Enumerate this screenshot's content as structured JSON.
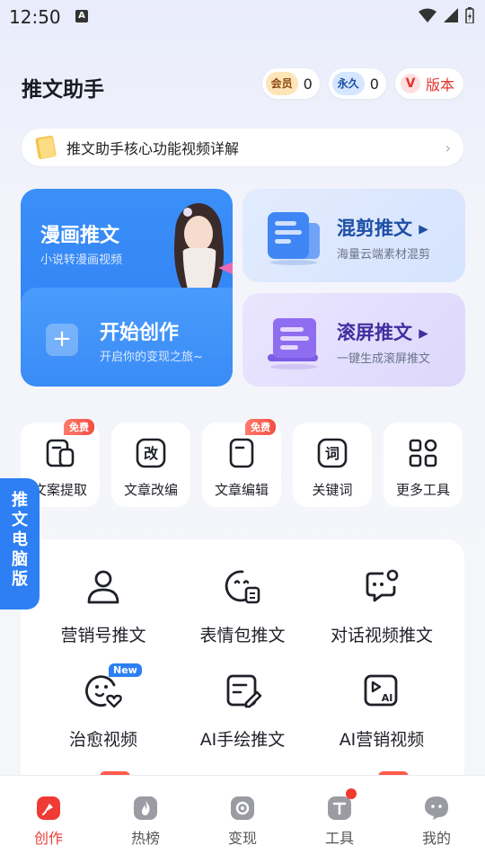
{
  "status_bar": {
    "time": "12:50",
    "indicator": "A"
  },
  "header": {
    "title": "推文助手",
    "vip_label": "会员",
    "vip_count": "0",
    "perm_label": "永久",
    "perm_count": "0",
    "version_icon": "V",
    "version_label": "版本"
  },
  "banner": {
    "text": "推文助手核心功能视频详解",
    "icon": "book-icon"
  },
  "cards": {
    "comic": {
      "title": "漫画推文",
      "subtitle": "小说转漫画视频"
    },
    "start": {
      "title": "开始创作",
      "subtitle": "开启你的变现之旅~"
    },
    "mix": {
      "title": "混剪推文 ▸",
      "subtitle": "海量云端素材混剪"
    },
    "scroll": {
      "title": "滚屏推文 ▸",
      "subtitle": "一键生成滚屏推文"
    }
  },
  "tools": [
    {
      "label": "文案提取",
      "badge": "免费",
      "icon": "extract-icon"
    },
    {
      "label": "文章改编",
      "badge": "",
      "icon": "rewrite-icon",
      "glyph": "改"
    },
    {
      "label": "文章编辑",
      "badge": "免费",
      "icon": "edit-doc-icon"
    },
    {
      "label": "关键词",
      "badge": "",
      "icon": "keyword-icon",
      "glyph": "词"
    },
    {
      "label": "更多工具",
      "badge": "",
      "icon": "grid-icon"
    }
  ],
  "pc_float": {
    "chars": [
      "推",
      "文",
      "电",
      "脑",
      "版"
    ]
  },
  "features": [
    {
      "label": "营销号推文",
      "icon": "user-icon"
    },
    {
      "label": "表情包推文",
      "icon": "emoji-icon"
    },
    {
      "label": "对话视频推文",
      "icon": "chat-icon"
    },
    {
      "label": "治愈视频",
      "icon": "heal-icon",
      "badge": "New"
    },
    {
      "label": "AI手绘推文",
      "icon": "draw-icon"
    },
    {
      "label": "AI营销视频",
      "icon": "ai-video-icon",
      "glyph": "AI"
    }
  ],
  "nav": [
    {
      "label": "创作",
      "active": true,
      "icon": "create-icon"
    },
    {
      "label": "热榜",
      "active": false,
      "icon": "fire-icon"
    },
    {
      "label": "变现",
      "active": false,
      "icon": "monetize-icon"
    },
    {
      "label": "工具",
      "active": false,
      "icon": "tools-icon",
      "dot": true
    },
    {
      "label": "我的",
      "active": false,
      "icon": "profile-icon"
    }
  ],
  "colors": {
    "accent": "#2d7ff3",
    "active": "#ef3b35"
  }
}
